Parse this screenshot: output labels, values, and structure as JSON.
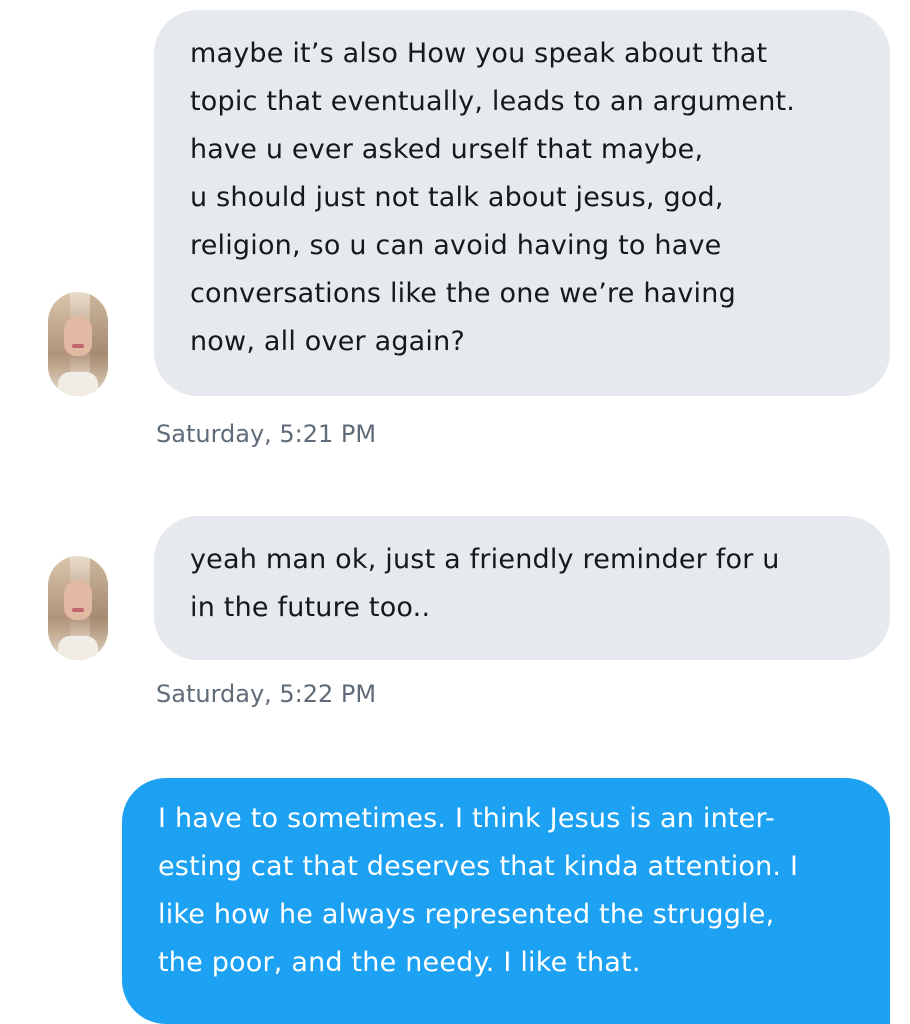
{
  "messages": [
    {
      "sender": "contact",
      "lines": [
        "maybe it’s also How you speak about that",
        "topic that eventually, leads to an argument.",
        "have u ever asked urself that maybe,",
        "u should just not talk about jesus, god,",
        "religion, so u can avoid having to have",
        "conversations like the one we’re having",
        "now, all over again?"
      ],
      "timestamp": "Saturday, 5:21 PM"
    },
    {
      "sender": "contact",
      "lines": [
        "yeah man ok, just a friendly reminder for u",
        "in the future too.."
      ],
      "timestamp": "Saturday, 5:22 PM"
    },
    {
      "sender": "me",
      "lines": [
        "I have to sometimes. I think Jesus is an inter-",
        "esting cat that deserves that kinda attention. I",
        "like how he always represented the struggle,",
        "the poor, and the needy. I like that."
      ]
    }
  ],
  "colors": {
    "incoming_bubble": "#e6e9ed",
    "outgoing_bubble": "#1da1f2",
    "timestamp_text": "#5f6b78"
  },
  "icons": {
    "avatar": "contact-avatar-photo"
  }
}
